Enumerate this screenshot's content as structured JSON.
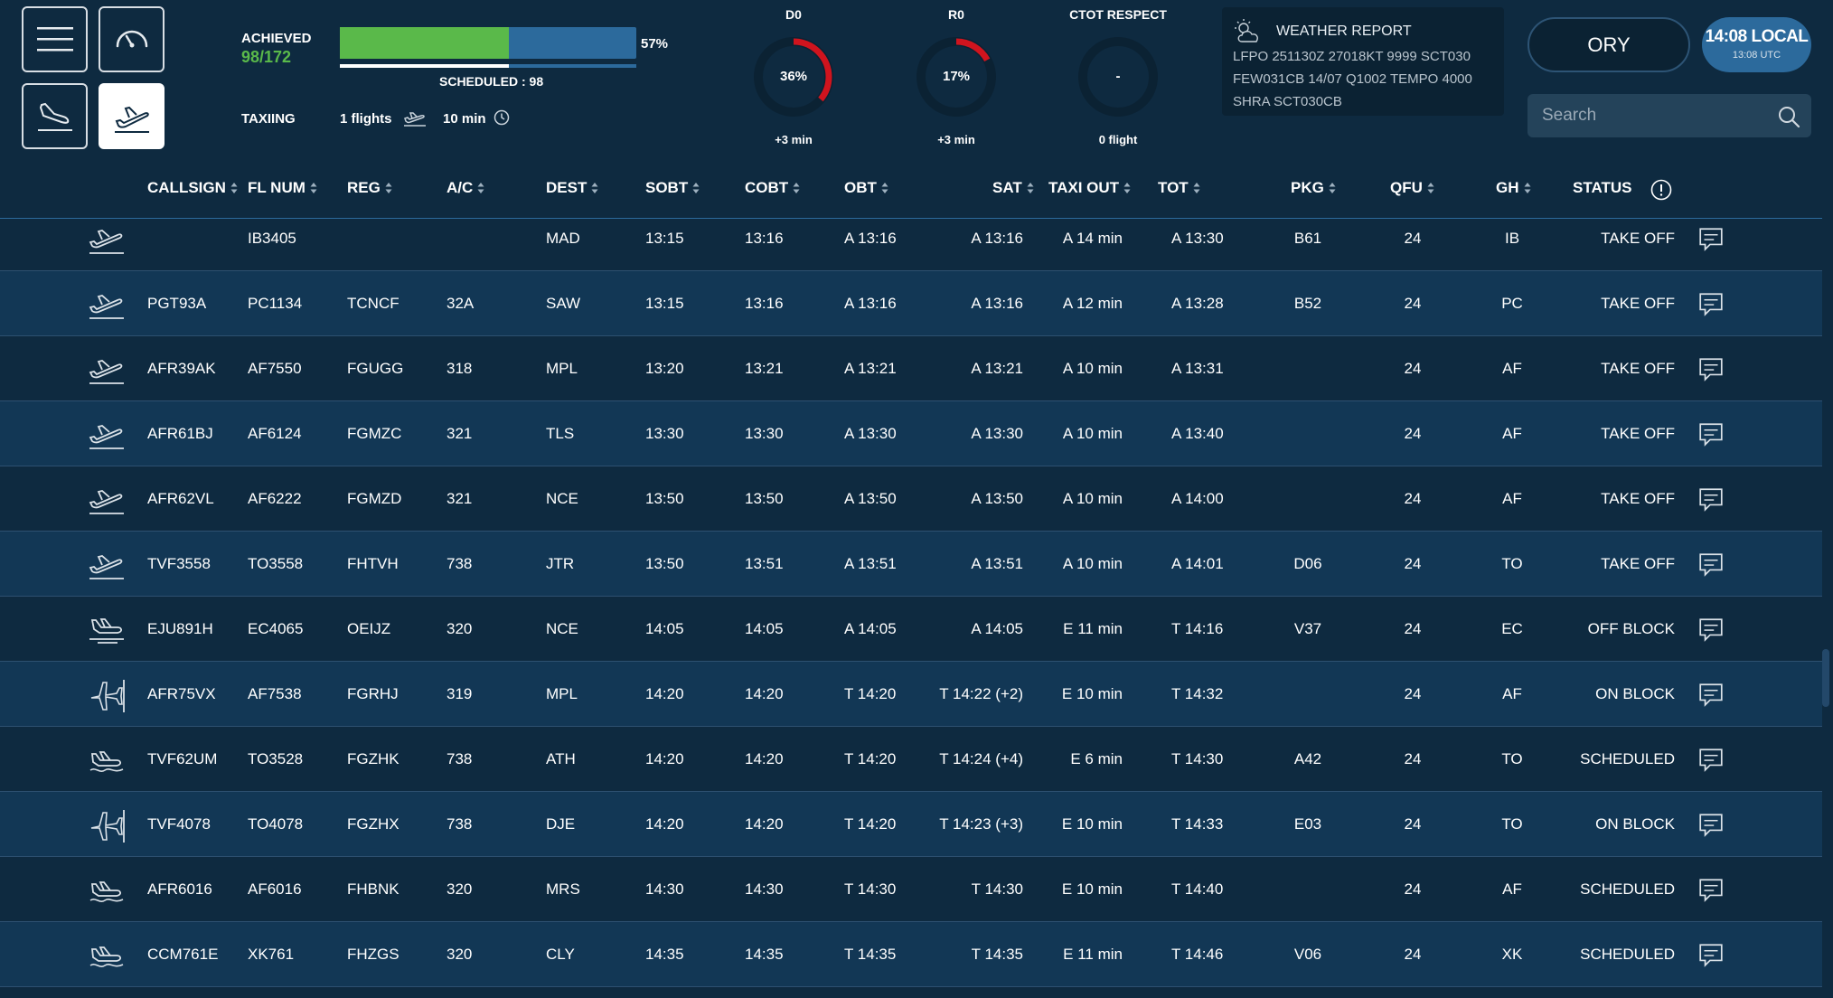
{
  "header": {
    "nav_buttons": [
      {
        "name": "menu",
        "icon": "hamburger-menu-icon"
      },
      {
        "name": "dashboard",
        "icon": "gauge-icon"
      },
      {
        "name": "arrivals",
        "icon": "plane-landing-icon"
      },
      {
        "name": "departures",
        "icon": "plane-takeoff-icon",
        "active": true
      }
    ],
    "achieved": {
      "label": "ACHIEVED",
      "value": "98/172",
      "percent": 57,
      "percent_label": "57%"
    },
    "scheduled": {
      "label": "SCHEDULED : 98",
      "fraction": 0.57
    },
    "taxiing": {
      "label": "TAXIING",
      "flights": "1 flights",
      "time": "10 min"
    },
    "gauges": [
      {
        "title": "D0",
        "value": "36%",
        "percent": 36,
        "sub": "+3 min",
        "color": "#d0141e"
      },
      {
        "title": "R0",
        "value": "17%",
        "percent": 17,
        "sub": "+3 min",
        "color": "#d0141e"
      },
      {
        "title": "CTOT RESPECT",
        "value": "-",
        "percent": 0,
        "sub": "0 flight",
        "color": "#d0141e"
      }
    ],
    "weather": {
      "title": "WEATHER REPORT",
      "lines": [
        "LFPO 251130Z 27018KT 9999 SCT030",
        "FEW031CB 14/07 Q1002 TEMPO 4000",
        "SHRA SCT030CB"
      ]
    },
    "airport": "ORY",
    "clock": {
      "local": "14:08 LOCAL",
      "utc": "13:08 UTC"
    },
    "search": {
      "placeholder": "Search"
    }
  },
  "table": {
    "columns": [
      "CALLSIGN",
      "FL NUM",
      "REG",
      "A/C",
      "DEST",
      "SOBT",
      "COBT",
      "OBT",
      "SAT",
      "TAXI OUT",
      "TOT",
      "PKG",
      "QFU",
      "GH",
      "STATUS"
    ],
    "rows": [
      {
        "icon": "takeoff",
        "callsign": "",
        "flnum": "IB3405",
        "reg": "",
        "ac": "",
        "dest": "MAD",
        "sobt": "13:15",
        "cobt": "13:16",
        "obt": "A 13:16",
        "sat": "A 13:16",
        "taxi": "A 14 min",
        "tot": "A 13:30",
        "pkg": "B61",
        "qfu": "24",
        "gh": "IB",
        "status": "TAKE OFF"
      },
      {
        "icon": "takeoff",
        "callsign": "PGT93A",
        "flnum": "PC1134",
        "reg": "TCNCF",
        "ac": "32A",
        "dest": "SAW",
        "sobt": "13:15",
        "cobt": "13:16",
        "obt": "A 13:16",
        "sat": "A 13:16",
        "taxi": "A 12 min",
        "tot": "A 13:28",
        "pkg": "B52",
        "qfu": "24",
        "gh": "PC",
        "status": "TAKE OFF"
      },
      {
        "icon": "takeoff",
        "callsign": "AFR39AK",
        "flnum": "AF7550",
        "reg": "FGUGG",
        "ac": "318",
        "dest": "MPL",
        "sobt": "13:20",
        "cobt": "13:21",
        "obt": "A 13:21",
        "sat": "A 13:21",
        "taxi": "A 10 min",
        "tot": "A 13:31",
        "pkg": "",
        "qfu": "24",
        "gh": "AF",
        "status": "TAKE OFF"
      },
      {
        "icon": "takeoff",
        "callsign": "AFR61BJ",
        "flnum": "AF6124",
        "reg": "FGMZC",
        "ac": "321",
        "dest": "TLS",
        "sobt": "13:30",
        "cobt": "13:30",
        "obt": "A 13:30",
        "sat": "A 13:30",
        "taxi": "A 10 min",
        "tot": "A 13:40",
        "pkg": "",
        "qfu": "24",
        "gh": "AF",
        "status": "TAKE OFF"
      },
      {
        "icon": "takeoff",
        "callsign": "AFR62VL",
        "flnum": "AF6222",
        "reg": "FGMZD",
        "ac": "321",
        "dest": "NCE",
        "sobt": "13:50",
        "cobt": "13:50",
        "obt": "A 13:50",
        "sat": "A 13:50",
        "taxi": "A 10 min",
        "tot": "A 14:00",
        "pkg": "",
        "qfu": "24",
        "gh": "AF",
        "status": "TAKE OFF"
      },
      {
        "icon": "takeoff",
        "callsign": "TVF3558",
        "flnum": "TO3558",
        "reg": "FHTVH",
        "ac": "738",
        "dest": "JTR",
        "sobt": "13:50",
        "cobt": "13:51",
        "obt": "A 13:51",
        "sat": "A 13:51",
        "taxi": "A 10 min",
        "tot": "A 14:01",
        "pkg": "D06",
        "qfu": "24",
        "gh": "TO",
        "status": "TAKE OFF"
      },
      {
        "icon": "offblock",
        "callsign": "EJU891H",
        "flnum": "EC4065",
        "reg": "OEIJZ",
        "ac": "320",
        "dest": "NCE",
        "sobt": "14:05",
        "cobt": "14:05",
        "obt": "A 14:05",
        "sat": "A 14:05",
        "taxi": "E 11 min",
        "tot": "T 14:16",
        "pkg": "V37",
        "qfu": "24",
        "gh": "EC",
        "status": "OFF BLOCK"
      },
      {
        "icon": "onblock",
        "callsign": "AFR75VX",
        "flnum": "AF7538",
        "reg": "FGRHJ",
        "ac": "319",
        "dest": "MPL",
        "sobt": "14:20",
        "cobt": "14:20",
        "obt": "T 14:20",
        "sat": "T 14:22 (+2)",
        "taxi": "E 10 min",
        "tot": "T 14:32",
        "pkg": "",
        "qfu": "24",
        "gh": "AF",
        "status": "ON BLOCK"
      },
      {
        "icon": "scheduled",
        "callsign": "TVF62UM",
        "flnum": "TO3528",
        "reg": "FGZHK",
        "ac": "738",
        "dest": "ATH",
        "sobt": "14:20",
        "cobt": "14:20",
        "obt": "T 14:20",
        "sat": "T 14:24 (+4)",
        "taxi": "E 6 min",
        "tot": "T 14:30",
        "pkg": "A42",
        "qfu": "24",
        "gh": "TO",
        "status": "SCHEDULED"
      },
      {
        "icon": "onblock",
        "callsign": "TVF4078",
        "flnum": "TO4078",
        "reg": "FGZHX",
        "ac": "738",
        "dest": "DJE",
        "sobt": "14:20",
        "cobt": "14:20",
        "obt": "T 14:20",
        "sat": "T 14:23 (+3)",
        "taxi": "E 10 min",
        "tot": "T 14:33",
        "pkg": "E03",
        "qfu": "24",
        "gh": "TO",
        "status": "ON BLOCK"
      },
      {
        "icon": "scheduled",
        "callsign": "AFR6016",
        "flnum": "AF6016",
        "reg": "FHBNK",
        "ac": "320",
        "dest": "MRS",
        "sobt": "14:30",
        "cobt": "14:30",
        "obt": "T 14:30",
        "sat": "T 14:30",
        "taxi": "E 10 min",
        "tot": "T 14:40",
        "pkg": "",
        "qfu": "24",
        "gh": "AF",
        "status": "SCHEDULED"
      },
      {
        "icon": "scheduled",
        "callsign": "CCM761E",
        "flnum": "XK761",
        "reg": "FHZGS",
        "ac": "320",
        "dest": "CLY",
        "sobt": "14:35",
        "cobt": "14:35",
        "obt": "T 14:35",
        "sat": "T 14:35",
        "taxi": "E 11 min",
        "tot": "T 14:46",
        "pkg": "V06",
        "qfu": "24",
        "gh": "XK",
        "status": "SCHEDULED"
      }
    ]
  },
  "colors": {
    "background": "#0e2a40",
    "accent_blue": "#2c6a9c",
    "achieved_green": "#5ab94a",
    "alert_red": "#d0141e"
  }
}
